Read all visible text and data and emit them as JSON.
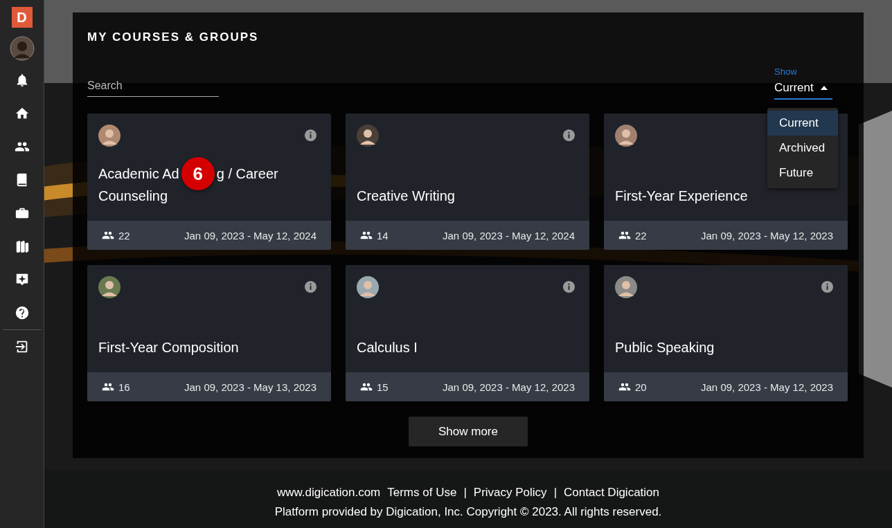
{
  "sidebar": {
    "logo": "D",
    "items": [
      {
        "kind": "bell"
      },
      {
        "kind": "home"
      },
      {
        "kind": "people"
      },
      {
        "kind": "book"
      },
      {
        "kind": "briefcase"
      },
      {
        "kind": "books"
      },
      {
        "kind": "sparkle"
      },
      {
        "kind": "help"
      },
      {
        "kind": "logout"
      }
    ]
  },
  "heading": "MY COURSES & GROUPS",
  "search": {
    "placeholder": "Search"
  },
  "show": {
    "label": "Show",
    "value": "Current",
    "expanded": true,
    "options": [
      {
        "label": "Current",
        "selected": true
      },
      {
        "label": "Archived",
        "selected": false
      },
      {
        "label": "Future",
        "selected": false
      }
    ]
  },
  "cards": [
    {
      "title_lines": [
        [
          "Academic Ad",
          "g / Career"
        ],
        [
          "Counseling"
        ]
      ],
      "badge": "6",
      "members": "22",
      "dates": "Jan 09, 2023 - May 12, 2024",
      "info": true
    },
    {
      "title_lines": [
        [
          "Creative Writing"
        ]
      ],
      "members": "14",
      "dates": "Jan 09, 2023 - May 12, 2024",
      "info": true
    },
    {
      "title_lines": [
        [
          "First-Year Experience"
        ]
      ],
      "members": "22",
      "dates": "Jan 09, 2023 - May 12, 2023",
      "info": false
    },
    {
      "title_lines": [
        [
          "First-Year Composition"
        ]
      ],
      "members": "16",
      "dates": "Jan 09, 2023 - May 13, 2023",
      "info": true
    },
    {
      "title_lines": [
        [
          "Calculus I"
        ]
      ],
      "members": "15",
      "dates": "Jan 09, 2023 - May 12, 2023",
      "info": true
    },
    {
      "title_lines": [
        [
          "Public Speaking"
        ]
      ],
      "members": "20",
      "dates": "Jan 09, 2023 - May 12, 2023",
      "info": true
    }
  ],
  "show_more": "Show more",
  "footer": {
    "site": "www.digication.com",
    "links": [
      "Terms of Use",
      "Privacy Policy",
      "Contact Digication"
    ],
    "separator": "|",
    "copyright": "Platform provided by Digication, Inc. Copyright © 2023. All rights reserved."
  }
}
